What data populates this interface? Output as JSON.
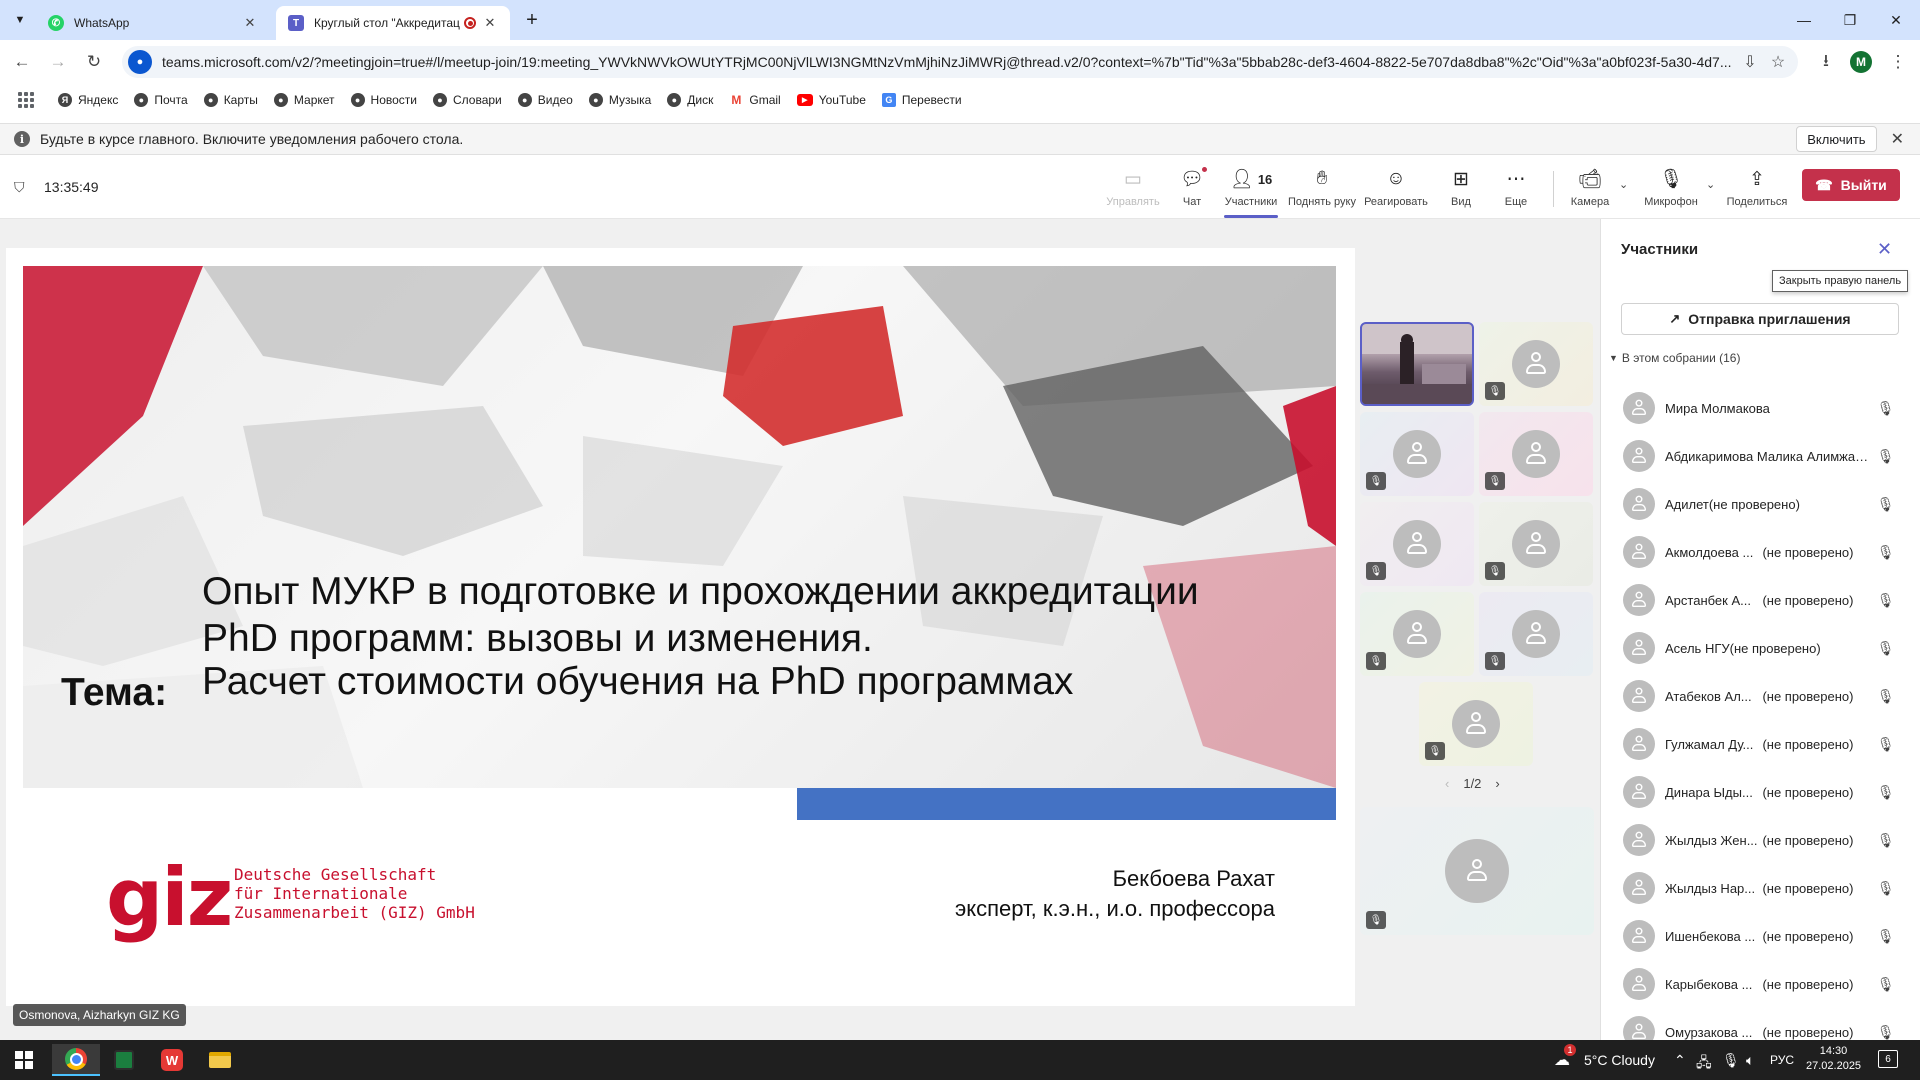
{
  "browser": {
    "tabs": [
      {
        "title": "WhatsApp",
        "icon": "whatsapp-icon",
        "color": "#25d366"
      },
      {
        "title": "Круглый стол \"Аккредитац",
        "icon": "teams-icon",
        "color": "#5b5fc7"
      }
    ],
    "url": "teams.microsoft.com/v2/?meetingjoin=true#/l/meetup-join/19:meeting_YWVkNWVkOWUtYTRjMC00NjVlLWI3NGMtNzVmMjhiNzJiMWRj@thread.v2/0?context=%7b\"Tid\"%3a\"5bbab28c-def3-4604-8822-5e707da8dba8\"%2c\"Oid\"%3a\"a0bf023f-5a30-4d7...",
    "profile_initial": "M",
    "bookmarks": [
      {
        "label": "Яндекс",
        "icon": "yandex-icon",
        "color": "#444444"
      },
      {
        "label": "Почта",
        "icon": "mail-icon",
        "color": "#444444"
      },
      {
        "label": "Карты",
        "icon": "maps-icon",
        "color": "#444444"
      },
      {
        "label": "Маркет",
        "icon": "market-icon",
        "color": "#444444"
      },
      {
        "label": "Новости",
        "icon": "news-icon",
        "color": "#444444"
      },
      {
        "label": "Словари",
        "icon": "dictionary-icon",
        "color": "#444444"
      },
      {
        "label": "Видео",
        "icon": "video-icon",
        "color": "#444444"
      },
      {
        "label": "Музыка",
        "icon": "music-icon",
        "color": "#444444"
      },
      {
        "label": "Диск",
        "icon": "disk-icon",
        "color": "#444444"
      },
      {
        "label": "Gmail",
        "icon": "gmail-icon",
        "color": "#ea4335"
      },
      {
        "label": "YouTube",
        "icon": "youtube-icon",
        "color": "#ff0000"
      },
      {
        "label": "Перевести",
        "icon": "translate-icon",
        "color": "#4285f4"
      }
    ]
  },
  "notification": {
    "text": "Будьте в курсе главного. Включите уведомления рабочего стола.",
    "enable_label": "Включить"
  },
  "meeting": {
    "timer": "13:35:49",
    "controls": {
      "manage": "Управлять",
      "chat": "Чат",
      "participants": "Участники",
      "participants_count": "16",
      "raise_hand": "Поднять руку",
      "react": "Реагировать",
      "view": "Вид",
      "more": "Еще",
      "camera": "Камера",
      "mic": "Микрофон",
      "share": "Поделиться",
      "leave": "Выйти"
    },
    "leave_color": "#c4314b",
    "accent_color": "#5b5fc7",
    "pager": "1/2",
    "speaker_label": "Osmonova, Aizharkyn GIZ KG"
  },
  "slide": {
    "title_line1": "Опыт МУКР в подготовке и прохождении аккредитации",
    "title_line2": "PhD программ: вызовы и изменения.",
    "topic_label": "Тема:",
    "subtitle": "Расчет стоимости обучения на PhD программах",
    "logo_text": "giz",
    "org_line1": "Deutsche Gesellschaft",
    "org_line2": "für Internationale",
    "org_line3": "Zusammenarbeit (GIZ) GmbH",
    "presenter_name": "Бекбоева Рахат",
    "presenter_role": "эксперт, к.э.н., и.о. профессора"
  },
  "panel": {
    "title": "Участники",
    "close_tooltip": "Закрыть правую панель",
    "invite_label": "Отправка приглашения",
    "section_label": "В этом собрании (16)",
    "participants": [
      {
        "name": "Мира Молмакова",
        "status": ""
      },
      {
        "name": "Абдикаримова Малика Алимжановна",
        "status": ""
      },
      {
        "name": "Адилет(не проверено)",
        "status": ""
      },
      {
        "name": "Акмолдоева ...",
        "status": "(не проверено)"
      },
      {
        "name": "Арстанбек А...",
        "status": "(не проверено)"
      },
      {
        "name": "Асель НГУ(не проверено)",
        "status": ""
      },
      {
        "name": "Атабеков Ал...",
        "status": "(не проверено)"
      },
      {
        "name": "Гулжамал Ду...",
        "status": "(не проверено)"
      },
      {
        "name": "Динара Ыды...",
        "status": "(не проверено)"
      },
      {
        "name": "Жылдыз Жен...",
        "status": "(не проверено)"
      },
      {
        "name": "Жылдыз Нар...",
        "status": "(не проверено)"
      },
      {
        "name": "Ишенбекова ...",
        "status": "(не проверено)"
      },
      {
        "name": "Карыбекова ...",
        "status": "(не проверено)"
      },
      {
        "name": "Омурзакова ...",
        "status": "(не проверено)"
      }
    ]
  },
  "taskbar": {
    "weather": "5°C  Cloudy",
    "weather_badge": "1",
    "lang": "РУС",
    "time": "14:30",
    "date": "27.02.2025",
    "notification_count": "6"
  }
}
